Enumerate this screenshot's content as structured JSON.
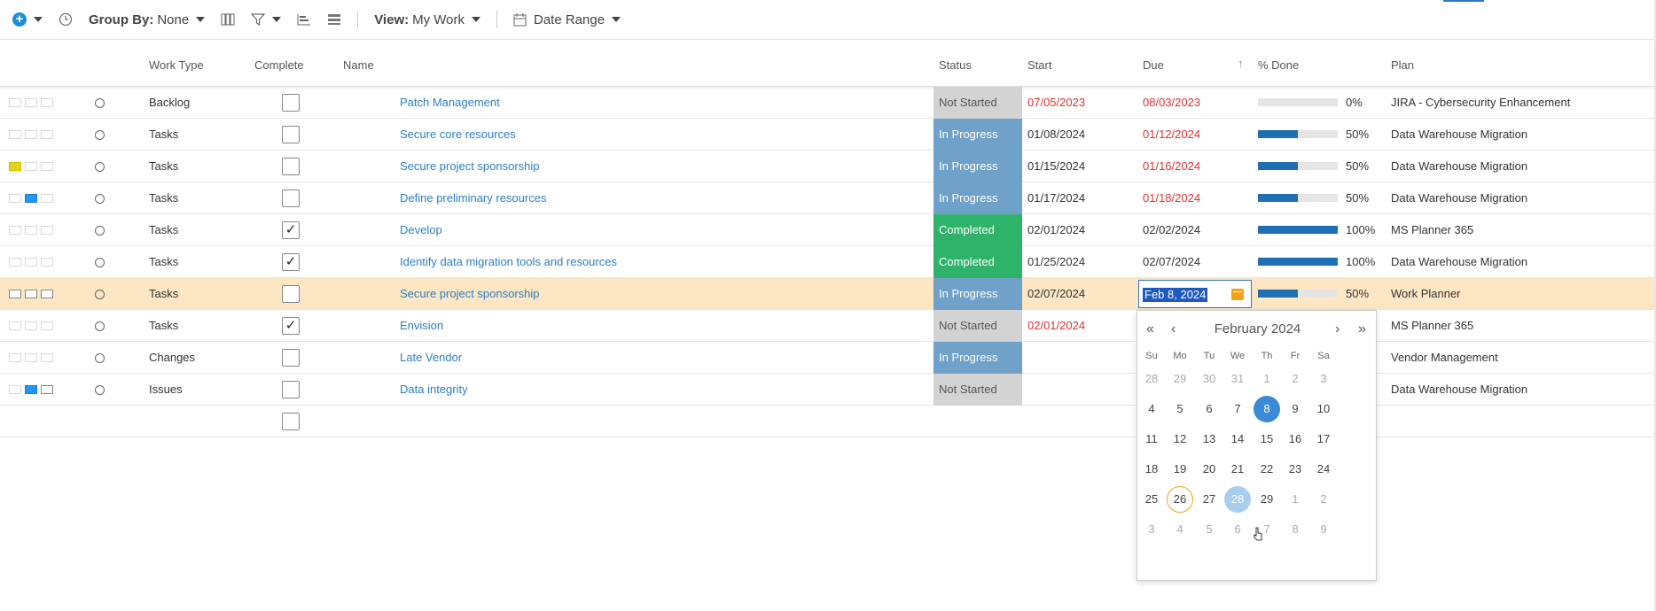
{
  "toolbar": {
    "group_by_label": "Group By:",
    "group_by_value": "None",
    "view_label": "View:",
    "view_value": "My Work",
    "date_range_label": "Date Range"
  },
  "columns": {
    "work_type": "Work Type",
    "complete": "Complete",
    "name": "Name",
    "status": "Status",
    "start": "Start",
    "due": "Due",
    "pct_done": "% Done",
    "plan": "Plan"
  },
  "rows": [
    {
      "work_type": "Backlog",
      "complete": false,
      "name": "Patch Management",
      "status": "Not Started",
      "start": "07/05/2023",
      "due": "08/03/2023",
      "progress": 0,
      "pct": "0%",
      "plan": "JIRA - Cybersecurity Enhancement"
    },
    {
      "work_type": "Tasks",
      "complete": false,
      "name": "Secure core resources",
      "status": "In Progress",
      "start": "01/08/2024",
      "due": "01/12/2024",
      "progress": 50,
      "pct": "50%",
      "plan": "Data Warehouse Migration"
    },
    {
      "work_type": "Tasks",
      "complete": false,
      "name": "Secure project sponsorship",
      "status": "In Progress",
      "start": "01/15/2024",
      "due": "01/16/2024",
      "progress": 50,
      "pct": "50%",
      "plan": "Data Warehouse Migration"
    },
    {
      "work_type": "Tasks",
      "complete": false,
      "name": "Define preliminary resources",
      "status": "In Progress",
      "start": "01/17/2024",
      "due": "01/18/2024",
      "progress": 50,
      "pct": "50%",
      "plan": "Data Warehouse Migration"
    },
    {
      "work_type": "Tasks",
      "complete": true,
      "name": "Develop",
      "status": "Completed",
      "start": "02/01/2024",
      "due": "02/02/2024",
      "progress": 100,
      "pct": "100%",
      "plan": "MS Planner 365"
    },
    {
      "work_type": "Tasks",
      "complete": true,
      "name": "Identify data migration tools and resources",
      "status": "Completed",
      "start": "01/25/2024",
      "due": "02/07/2024",
      "progress": 100,
      "pct": "100%",
      "plan": "Data Warehouse Migration"
    },
    {
      "work_type": "Tasks",
      "complete": false,
      "name": "Secure project sponsorship",
      "status": "In Progress",
      "start": "02/07/2024",
      "due": "",
      "progress": 50,
      "pct": "50%",
      "plan": "Work Planner"
    },
    {
      "work_type": "Tasks",
      "complete": true,
      "name": "Envision",
      "status": "Not Started",
      "start": "02/01/2024",
      "due": "",
      "progress": null,
      "pct": "",
      "plan": "MS Planner 365"
    },
    {
      "work_type": "Changes",
      "complete": false,
      "name": "Late Vendor",
      "status": "In Progress",
      "start": "",
      "due": "",
      "progress": null,
      "pct": "",
      "plan": "Vendor Management"
    },
    {
      "work_type": "Issues",
      "complete": false,
      "name": "Data integrity",
      "status": "Not Started",
      "start": "",
      "due": "",
      "progress": null,
      "pct": "",
      "plan": "Data Warehouse Migration"
    }
  ],
  "check_mark": "✓",
  "date_editor": {
    "value": "Feb 8, 2024"
  },
  "calendar": {
    "title": "February 2024",
    "nav_first": "«",
    "nav_prev": "‹",
    "nav_next": "›",
    "nav_last": "»",
    "weekdays": [
      "Su",
      "Mo",
      "Tu",
      "We",
      "Th",
      "Fr",
      "Sa"
    ],
    "weeks": [
      [
        "28",
        "29",
        "30",
        "31",
        "1",
        "2",
        "3"
      ],
      [
        "4",
        "5",
        "6",
        "7",
        "8",
        "9",
        "10"
      ],
      [
        "11",
        "12",
        "13",
        "14",
        "15",
        "16",
        "17"
      ],
      [
        "18",
        "19",
        "20",
        "21",
        "22",
        "23",
        "24"
      ],
      [
        "25",
        "26",
        "27",
        "28",
        "29",
        "1",
        "2"
      ],
      [
        "3",
        "4",
        "5",
        "6",
        "7",
        "8",
        "9"
      ]
    ]
  },
  "colors": {
    "accent": "#2b7fc7",
    "overdue": "#e23232",
    "in_progress": "#6fa1c9",
    "completed": "#2fb36a",
    "not_started": "#d3d3d3",
    "selected_row": "#fce6c4"
  },
  "icons": [
    "plus-icon",
    "clock-icon",
    "columns-icon",
    "filter-icon",
    "gantt-icon",
    "list-icon",
    "calendar-icon",
    "sort-up-icon",
    "note-icon",
    "comment-icon",
    "board-icon",
    "mouse-pointer-icon"
  ]
}
